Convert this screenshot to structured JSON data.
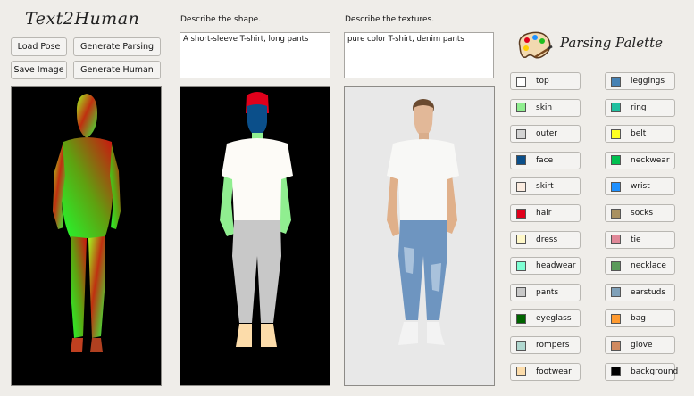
{
  "app": {
    "title": "Text2Human"
  },
  "toolbar": {
    "load_pose": "Load Pose",
    "generate_parsing": "Generate Parsing",
    "save_image": "Save Image",
    "generate_human": "Generate Human"
  },
  "shape": {
    "label": "Describe the shape.",
    "value": "A short-sleeve T-shirt, long pants"
  },
  "texture": {
    "label": "Describe the textures.",
    "value": "pure color T-shirt, denim pants"
  },
  "palette": {
    "title": "Parsing Palette",
    "left": [
      {
        "label": "top",
        "color": "#ffffff"
      },
      {
        "label": "skin",
        "color": "#90ee90"
      },
      {
        "label": "outer",
        "color": "#d3d3d3"
      },
      {
        "label": "face",
        "color": "#0b4f8a"
      },
      {
        "label": "skirt",
        "color": "#fbece0"
      },
      {
        "label": "hair",
        "color": "#e0001b"
      },
      {
        "label": "dress",
        "color": "#fff8c8"
      },
      {
        "label": "headwear",
        "color": "#7fffd4"
      },
      {
        "label": "pants",
        "color": "#c8c8c8"
      },
      {
        "label": "eyeglass",
        "color": "#006400"
      },
      {
        "label": "rompers",
        "color": "#b0d8d0"
      },
      {
        "label": "footwear",
        "color": "#fcdcaa"
      }
    ],
    "right": [
      {
        "label": "leggings",
        "color": "#4682b4"
      },
      {
        "label": "ring",
        "color": "#20c0a0"
      },
      {
        "label": "belt",
        "color": "#ffff20"
      },
      {
        "label": "neckwear",
        "color": "#00c050"
      },
      {
        "label": "wrist",
        "color": "#1e90ff"
      },
      {
        "label": "socks",
        "color": "#a89060"
      },
      {
        "label": "tie",
        "color": "#e08898"
      },
      {
        "label": "necklace",
        "color": "#5a9a5a"
      },
      {
        "label": "earstuds",
        "color": "#7fa0b8"
      },
      {
        "label": "bag",
        "color": "#ff9a30"
      },
      {
        "label": "glove",
        "color": "#d08a60"
      },
      {
        "label": "background",
        "color": "#000000"
      }
    ]
  }
}
